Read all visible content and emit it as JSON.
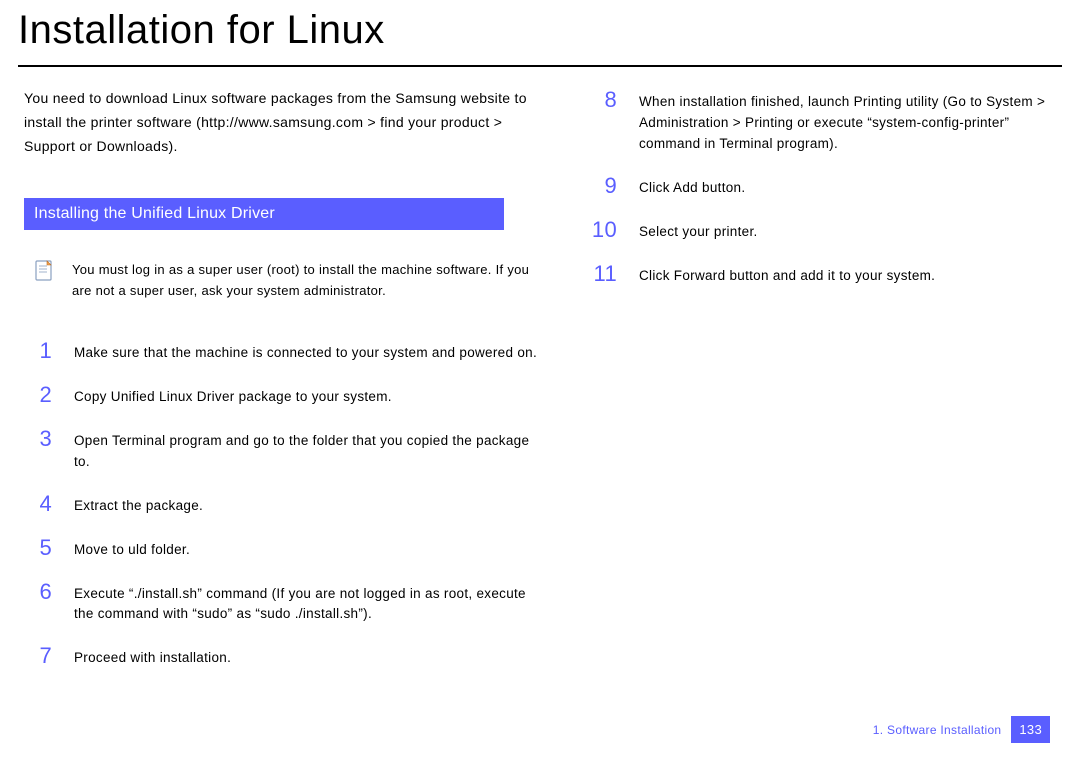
{
  "title": "Installation for Linux",
  "intro": "You need to download Linux software packages from the Samsung website to install the printer software (http://www.samsung.com > find your product > Support or Downloads).",
  "section_heading": "Installing the Unified Linux Driver",
  "note": "You must log in as a super user (root) to install the machine software. If you are not a super user, ask your system administrator.",
  "steps_left": [
    {
      "n": "1",
      "t": "Make sure that the machine is connected to your system and powered on."
    },
    {
      "n": "2",
      "t": "Copy Unified Linux Driver package to your system."
    },
    {
      "n": "3",
      "t": "Open Terminal program and go to the folder that you copied the package to."
    },
    {
      "n": "4",
      "t": "Extract the package."
    },
    {
      "n": "5",
      "t": "Move to uld folder."
    },
    {
      "n": "6",
      "t": "Execute “./install.sh” command (If you are not logged in as root, execute the command with “sudo” as “sudo ./install.sh”)."
    },
    {
      "n": "7",
      "t": "Proceed with installation."
    }
  ],
  "steps_right": [
    {
      "n": "8",
      "t": "When installation finished, launch Printing utility (Go to System > Administration > Printing or execute “system-config-printer” command in Terminal program)."
    },
    {
      "n": "9",
      "t": "Click Add button."
    },
    {
      "n": "10",
      "t": "Select your printer."
    },
    {
      "n": "11",
      "t": "Click Forward button and add it to your system."
    }
  ],
  "footer": {
    "label": "1.  Software Installation",
    "page": "133"
  }
}
